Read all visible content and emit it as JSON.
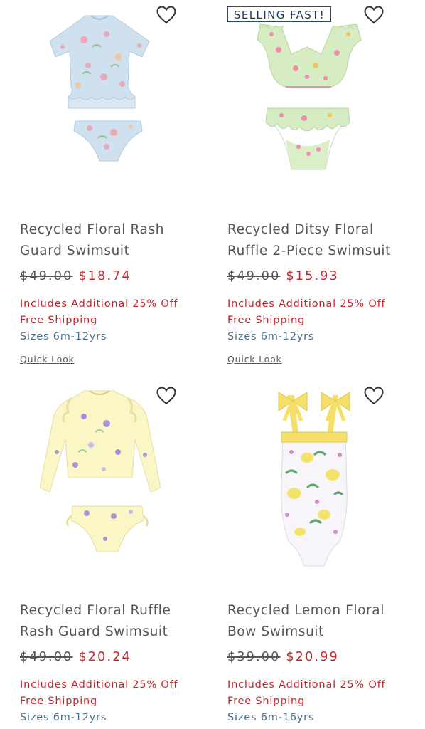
{
  "products": [
    {
      "title": "Recycled Floral Rash Guard Swimsuit",
      "badge": "",
      "old_price": "$49.00",
      "new_price": "$18.74",
      "promo": "Includes Additional 25% Off",
      "shipping": "Free Shipping",
      "sizes": "Sizes 6m-12yrs",
      "quick_look": "Quick Look",
      "colors": {
        "fabric": "#cfe0ee",
        "print": "#e8a9b9",
        "leaf": "#8fc58f"
      }
    },
    {
      "title": "Recycled Ditsy Floral Ruffle 2-Piece Swimsuit",
      "badge": "SELLING FAST!",
      "old_price": "$49.00",
      "new_price": "$15.93",
      "promo": "Includes Additional 25% Off",
      "shipping": "Free Shipping",
      "sizes": "Sizes 6m-12yrs",
      "quick_look": "Quick Look",
      "colors": {
        "fabric": "#d6ecc2",
        "print": "#f08bb0",
        "leaf": "#6fbf6a"
      }
    },
    {
      "title": "Recycled Floral Ruffle Rash Guard Swimsuit",
      "badge": "",
      "old_price": "$49.00",
      "new_price": "$20.24",
      "promo": "Includes Additional 25% Off",
      "shipping": "Free Shipping",
      "sizes": "Sizes 6m-12yrs",
      "quick_look": "",
      "colors": {
        "fabric": "#fbf6c6",
        "print": "#a993d6",
        "leaf": "#9ccf9a"
      }
    },
    {
      "title": "Recycled Lemon Floral Bow Swimsuit",
      "badge": "",
      "old_price": "$39.00",
      "new_price": "$20.99",
      "promo": "Includes Additional 25% Off",
      "shipping": "Free Shipping",
      "sizes": "Sizes 6m-16yrs",
      "quick_look": "",
      "colors": {
        "fabric": "#f7f4fa",
        "print": "#f3e36a",
        "leaf": "#5ea86a",
        "strap": "#f5df6a"
      }
    }
  ],
  "icons": {
    "wishlist": "heart-outline-icon"
  }
}
